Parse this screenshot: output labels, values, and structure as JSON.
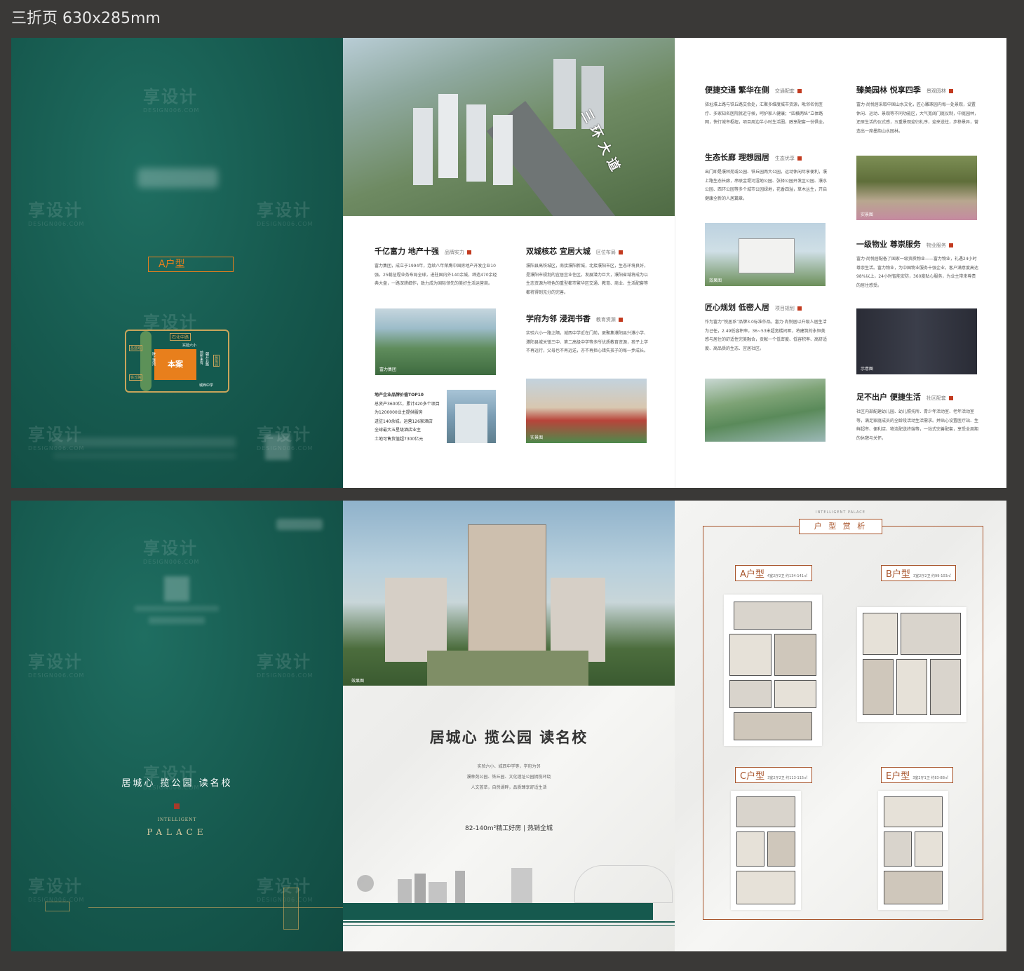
{
  "header": {
    "title": "三折页  630x285mm"
  },
  "colors": {
    "green": "#16594e",
    "gold": "#c9a55b",
    "orange": "#e87f1c",
    "accent_red": "#c23a1f",
    "brown": "#a8552c"
  },
  "watermark": {
    "text": "享设计",
    "sub": "DESIGN006.COM"
  },
  "front_cover": {
    "plan_badge": "A户型",
    "map": {
      "center": "本案",
      "top": "石化中路",
      "tag1": "实验六小",
      "left_top": "昌盛路",
      "left_mid": "陕上港湾",
      "left_bottom": "铁丘路",
      "right_a": "前所未有",
      "right_b": "朝开北路",
      "right_c": "昌隆园",
      "bottom_right": "城西中学"
    }
  },
  "inner": {
    "aerial": {
      "road": "三环大道"
    },
    "brand": {
      "title": "千亿富力 地产十强",
      "tag": "品牌实力",
      "text": "富力集团，成立于1994年，连续八年荣膺中国房地产开发企业10强。25载征程业务布局全球，进驻国内外140余城，缔造470余经典大盘，一路深耕细作，致力成为国际领先的美好生活运营商。",
      "caption": "富力集团",
      "stats": [
        "地产企业品牌价值TOP10",
        "总资产3600亿，累计420多个项目",
        "为1200000业主提供服务",
        "进驻140余城，运营126家酒店",
        "全球最大五星级酒店业主",
        "土地可售货值超7300亿元"
      ]
    },
    "dual_core": {
      "title": "双城核芯 宜居大城",
      "tag": "区位布局",
      "text": "濮阳县高铁城区，南接濮阳新城，北接濮阳市区，生态环境良好，是濮阳市规划的宜居宜业住区。发展潜力巨大，濮阳省域将成为以生态资源为特色的重型都市繁华区交通、教育、商业、生活配套等都将得到充分的完善。"
    },
    "school": {
      "title": "学府为邻 浸润书香",
      "tag": "教育资源",
      "text": "实验六小一路之隔，城西中学近在门前，更聚集濮阳县兴濮小学、濮阳县城关镇三中、第二高级中学等多所优质教育资源，孩子上学不再远行，父母也不再远送，亦不再担心错失孩子的每一步成长。",
      "caption": "实景图"
    },
    "traffic": {
      "title": "便捷交通 繁华在侧",
      "tag": "交通配套",
      "text": "驿址濮上路与铁丘路交会处，汇聚多维度城市资源，毗邻名优医疗、多家知名医院就近守候，呵护家人健康；“四横两纵”立体路网，快行城市枢纽，项目周边半小时生活圈，醇享配套一份俱全。"
    },
    "eco": {
      "title": "生态长廊 理想园居",
      "tag": "生态优享",
      "text": "出门即是濮林苑或公园、铁丘园两大公园，运动休闲尽享便利，濮上路生态长廊，串联金堤河湿地公园、张择公园开发区公园、濮水公园、西环公园等多个城市公园绿地，花香四溢，草木丛生，开启健康全新的人居篇章。",
      "caption": "效果图"
    },
    "craft": {
      "title": "匠心规划 低密人居",
      "tag": "项目规划",
      "text": "作为富力“悦居系”品牌3.0标准作品，富力·尚悦居以升级人居生活为己任，2.49低容积率，36~53米超宽楼间距，将建筑的永恒美感与居住的舒适性完美融合，贡献一个低密度、低容积率、高舒适度、高品质的生态、宜居社区。"
    },
    "garden": {
      "title": "臻美园林 悦享四季",
      "tag": "景观园林",
      "text": "富力·尚悦居采取中国山水文化，匠心雕琢园内每一处景观，设置休闲、运动、景观等不同功能区，大气宽阔门庭仪制，中庭园林，还原生活的仪式感，五重景观迎归礼序，迎来送往，步移景异，营造出一席墨韵山水园林。",
      "caption": "实景图"
    },
    "property": {
      "title": "一级物业 尊崇服务",
      "tag": "物业服务",
      "text": "富力·尚悦居配备了国家一级资质物业——富力物业，礼遇24小时尊崇生活。富力物业，为中国物业服务十强企业，客户满意度高达98%以上，24小时智能安防，360度贴心服务，为业主带来尊贵的居住感受。",
      "caption": "示意图"
    },
    "life": {
      "title": "足不出户 便捷生活",
      "tag": "社区配套",
      "text": "社区内部配建幼儿园、幼儿照托所、青少年活动室、老年活动室等，满足家庭成员的全龄段活动生活需求。并贴心设置医疗站、生鲜超市、便利店、物流配送终端等，一站式完善配套，享受全周期的休憩与关怀。"
    }
  },
  "back_cover": {
    "slogan": "居城心 揽公园 读名校",
    "english_small": "INTELLIGENT",
    "english_large": "PALACE"
  },
  "middle_back": {
    "caption": "效果图",
    "title": "居城心 揽公园 读名校",
    "lines": [
      "实验六小、城西中学等，学府为邻",
      "濮林苑公园、铁丘园、文化遗址公园拥揽环绕",
      "人文荟萃，自然湖畔，品质臻享舒适生活"
    ],
    "tagline": "82-140m²精工好房 | 热销全城"
  },
  "floorplans": {
    "title": "户 型 赏 析",
    "en": "INTELLIGENT PALACE",
    "items": [
      {
        "name": "A户型",
        "spec": "4室2厅2卫 约134-141㎡"
      },
      {
        "name": "B户型",
        "spec": "3室2厅2卫 约99-103㎡"
      },
      {
        "name": "C户型",
        "spec": "3室2厅2卫 约113-115㎡"
      },
      {
        "name": "E户型",
        "spec": "3室2厅1卫 约83-88㎡"
      }
    ]
  }
}
